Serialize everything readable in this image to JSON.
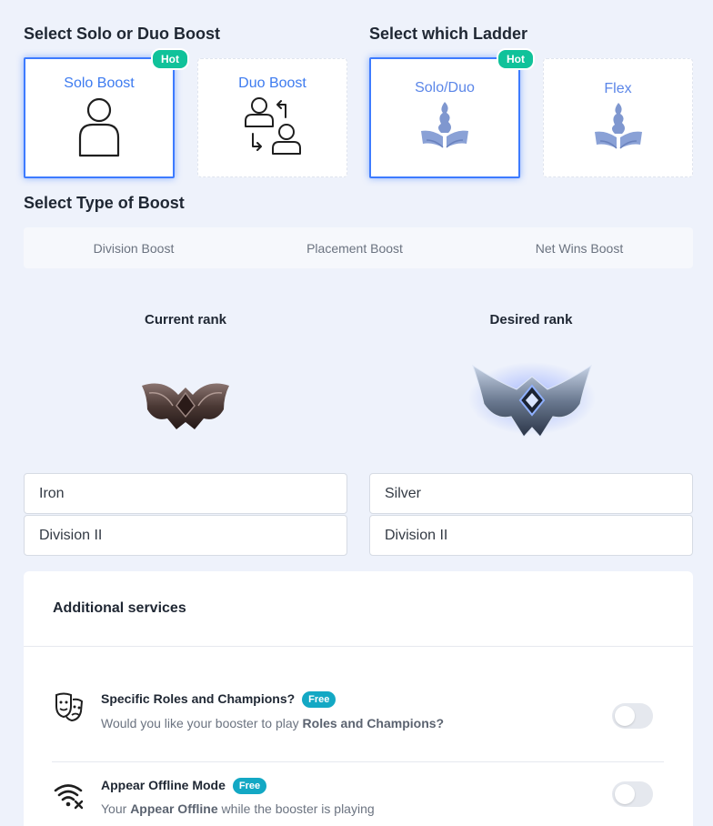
{
  "boost_type_section": {
    "title": "Select Solo or Duo Boost",
    "options": [
      {
        "label": "Solo Boost",
        "badge": "Hot",
        "selected": true
      },
      {
        "label": "Duo Boost",
        "selected": false
      }
    ]
  },
  "ladder_section": {
    "title": "Select which Ladder",
    "options": [
      {
        "label": "Solo/Duo",
        "badge": "Hot",
        "selected": true
      },
      {
        "label": "Flex",
        "selected": false
      }
    ]
  },
  "boost_kind_section": {
    "title": "Select Type of Boost",
    "tabs": [
      "Division Boost",
      "Placement Boost",
      "Net Wins Boost"
    ]
  },
  "current_rank": {
    "title": "Current rank",
    "tier": "Iron",
    "division": "Division II"
  },
  "desired_rank": {
    "title": "Desired rank",
    "tier": "Silver",
    "division": "Division II"
  },
  "additional_services": {
    "title": "Additional services",
    "items": [
      {
        "title": "Specific Roles and Champions?",
        "badge": "Free",
        "desc_prefix": "Would you like your booster to play ",
        "desc_bold": "Roles and Champions?",
        "desc_suffix": "",
        "enabled": false
      },
      {
        "title": "Appear Offline Mode",
        "badge": "Free",
        "desc_prefix": "Your ",
        "desc_bold": "Appear Offline",
        "desc_suffix": " while the booster is playing",
        "enabled": false
      }
    ]
  },
  "colors": {
    "accent": "#3d7bff",
    "hot_badge": "#10c29a",
    "free_badge": "#13a8c4",
    "background": "#eef2fb"
  }
}
